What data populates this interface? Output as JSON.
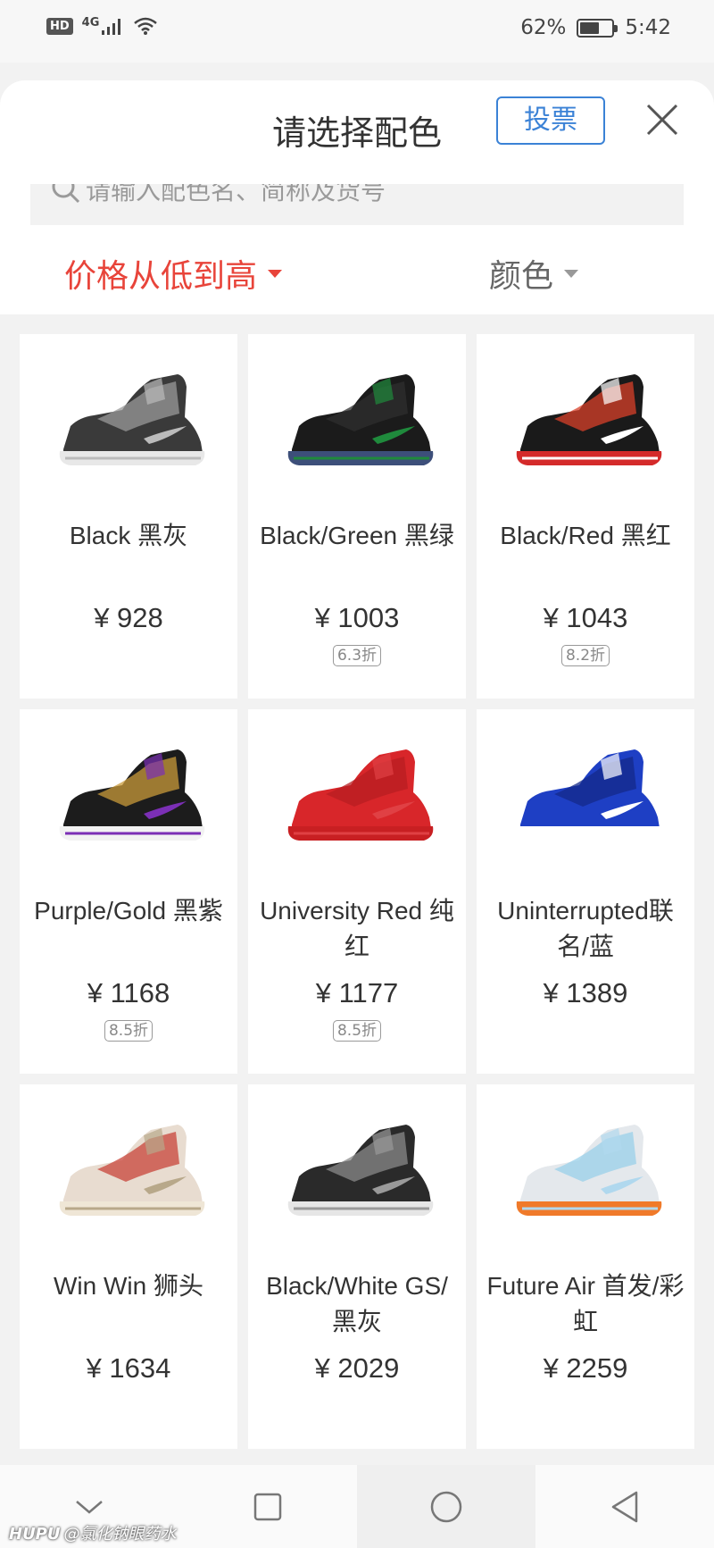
{
  "status_bar": {
    "hd": "HD",
    "network": "4G",
    "battery_percent": "62%",
    "battery_level": 0.62,
    "time": "5:42"
  },
  "header": {
    "title": "请选择配色",
    "vote_label": "投票",
    "search_placeholder": "请输入配色名、简称及货号"
  },
  "filters": {
    "sort_label": "价格从低到高",
    "color_label": "颜色",
    "sort_color": "#e8443a"
  },
  "products": [
    {
      "name": "Black 黑灰",
      "price": "¥ 928",
      "discount": ""
    },
    {
      "name": "Black/Green 黑绿",
      "price": "¥ 1003",
      "discount": "6.3折"
    },
    {
      "name": "Black/Red 黑红",
      "price": "¥ 1043",
      "discount": "8.2折"
    },
    {
      "name": "Purple/Gold 黑紫",
      "price": "¥ 1168",
      "discount": "8.5折"
    },
    {
      "name": "University Red 纯红",
      "price": "¥ 1177",
      "discount": "8.5折"
    },
    {
      "name": "Uninterrupted联名/蓝",
      "price": "¥ 1389",
      "discount": ""
    },
    {
      "name": "Win Win 狮头",
      "price": "¥ 1634",
      "discount": ""
    },
    {
      "name": "Black/White GS/黑灰",
      "price": "¥ 2029",
      "discount": ""
    },
    {
      "name": "Future Air 首发/彩虹",
      "price": "¥ 2259",
      "discount": ""
    }
  ],
  "shoe_colors": [
    {
      "upper": "#3a3a3a",
      "accent": "#9a9a9a",
      "sole": "#e8e8e8",
      "trim": "#bbbbbb"
    },
    {
      "upper": "#1b1b1b",
      "accent": "#2f2f2f",
      "sole": "#3d4f7a",
      "trim": "#1f8a3c"
    },
    {
      "upper": "#1a1a1a",
      "accent": "#d8402a",
      "sole": "#d42a2a",
      "trim": "#ffffff"
    },
    {
      "upper": "#1c1c1c",
      "accent": "#c89a3a",
      "sole": "#f2f2f2",
      "trim": "#7b2fb5"
    },
    {
      "upper": "#d8262a",
      "accent": "#b81e22",
      "sole": "#c81f22",
      "trim": "#e04044"
    },
    {
      "upper": "#1e3fc4",
      "accent": "#142a8a",
      "sole": "#ffffff",
      "trim": "#ffffff"
    },
    {
      "upper": "#e8dcd0",
      "accent": "#c8443a",
      "sole": "#efe6d6",
      "trim": "#b8a88a"
    },
    {
      "upper": "#2a2a2a",
      "accent": "#8a8a8a",
      "sole": "#e6e6e6",
      "trim": "#9a9a9a"
    },
    {
      "upper": "#e4e8ec",
      "accent": "#9ad0ea",
      "sole": "#f07a2a",
      "trim": "#b0d8ee"
    }
  ],
  "watermark": {
    "brand": "HUPU",
    "handle": "@氯化钠眼药水"
  }
}
